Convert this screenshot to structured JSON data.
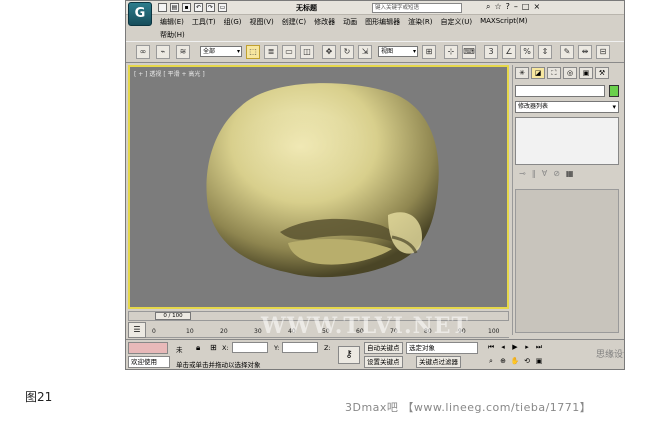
{
  "app": {
    "logo": "G",
    "title": "无标题",
    "search_placeholder": "键入关键字或短语"
  },
  "menu": {
    "items": [
      "编辑(E)",
      "工具(T)",
      "组(G)",
      "视图(V)",
      "创建(C)",
      "修改器",
      "动画",
      "图形编辑器",
      "渲染(R)",
      "自定义(U)",
      "MAXScript(M)"
    ],
    "help": "帮助(H)"
  },
  "toolbar": {
    "selection_filter": "全部",
    "ref_coord": "视图"
  },
  "viewport": {
    "label": "[ + ] 透视 [ 平滑 + 高光 ]"
  },
  "command_panel": {
    "modifier_list": "修改器列表"
  },
  "timeline": {
    "thumb": "0 / 100",
    "ticks": [
      "0",
      "10",
      "20",
      "30",
      "40",
      "50",
      "60",
      "70",
      "80",
      "90",
      "100"
    ]
  },
  "status": {
    "selection": "未",
    "x_label": "X:",
    "y_label": "Y:",
    "z_label": "Z:",
    "welcome": "欢迎使用",
    "prompt": "单击或单击并拖动以选择对象",
    "auto_key": "自动关键点",
    "set_key": "设置关键点",
    "selected_obj": "选定对象",
    "key_filters": "关键点过滤器"
  },
  "overlay": {
    "watermark_mid": "WWW.TLVI.NET",
    "watermark_right": "思缘设计论坛 www.MISSYUAN.COM",
    "caption": "图21",
    "footer": "3Dmax吧 【www.lineeg.com/tieba/1771】"
  },
  "colors": {
    "viewport_border": "#e6d84a",
    "viewport_bg": "#7c7c7c",
    "object_color": "#d8cf8c",
    "object_color_box": "#6ad04c"
  }
}
